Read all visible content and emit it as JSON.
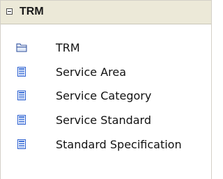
{
  "panel": {
    "title": "TRM",
    "collapse_icon": "collapse-minus-icon",
    "items": [
      {
        "label": "TRM",
        "icon": "folder-icon"
      },
      {
        "label": "Service Area",
        "icon": "element-icon"
      },
      {
        "label": "Service Category",
        "icon": "element-icon"
      },
      {
        "label": "Service Standard",
        "icon": "element-icon"
      },
      {
        "label": "Standard Specification",
        "icon": "element-icon"
      }
    ]
  },
  "colors": {
    "header_bg": "#ece9d8",
    "element_icon_blue": "#3a6fd8"
  }
}
